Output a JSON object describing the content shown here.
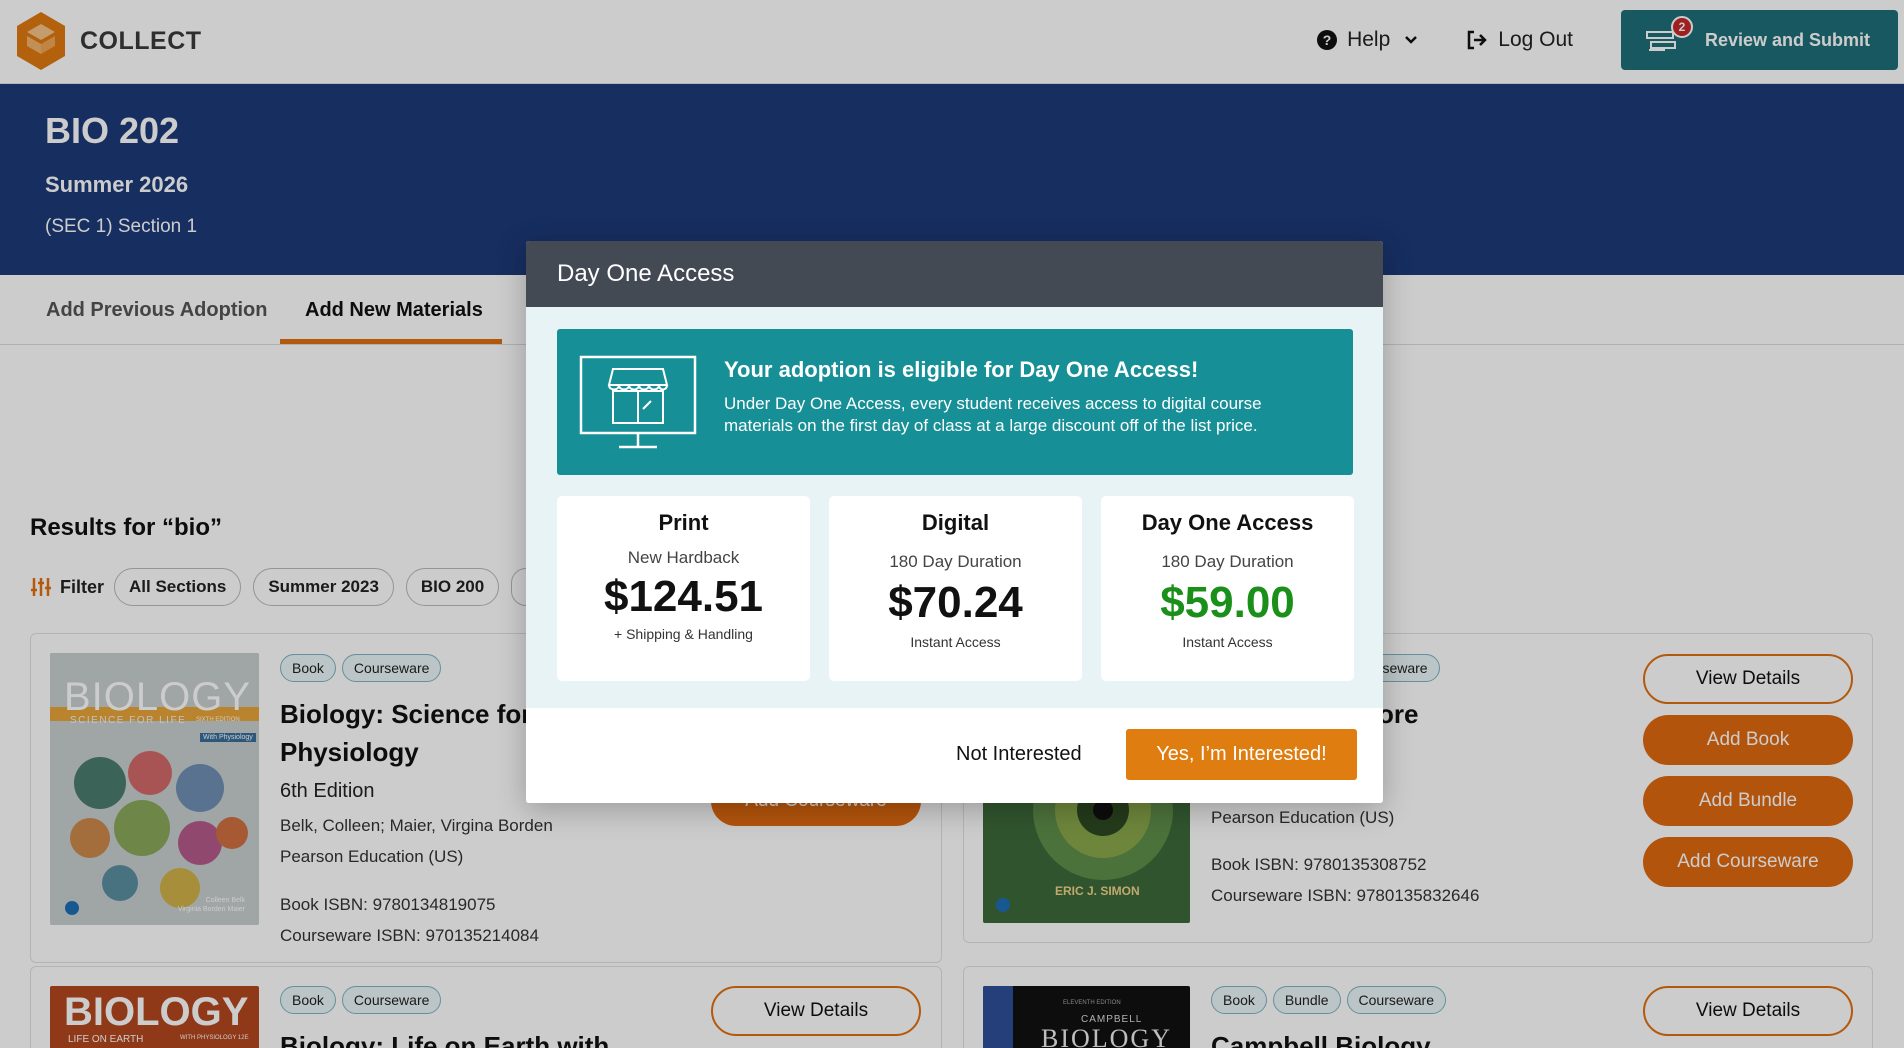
{
  "app": {
    "name": "COLLECT"
  },
  "header": {
    "help_label": "Help",
    "logout_label": "Log Out",
    "review_label": "Review and Submit",
    "review_badge": "2"
  },
  "course": {
    "code": "BIO 202",
    "term": "Summer 2026",
    "section": "(SEC 1) Section 1"
  },
  "tabs": [
    {
      "label": "Add Previous Adoption"
    },
    {
      "label": "Add New Materials"
    }
  ],
  "results": {
    "title": "Results for “bio”",
    "filter_label": "Filter",
    "chips": [
      "All Sections",
      "Summer 2023",
      "BIO 200"
    ]
  },
  "cards": [
    {
      "tags": [
        "Book",
        "Courseware"
      ],
      "title_line1": "Biology: Science for L",
      "title_line2": "Physiology",
      "edition": "6th Edition",
      "authors": "Belk, Colleen; Maier, Virgina Borden",
      "publisher": "Pearson Education (US)",
      "book_isbn": "Book ISBN: 9780134819075",
      "courseware_isbn": "Courseware ISBN: 970135214084",
      "buttons": [
        "Add Courseware"
      ]
    },
    {
      "tags": [
        "urseware"
      ],
      "title": "ore",
      "publisher": "Pearson Education (US)",
      "book_isbn": "Book ISBN: 9780135308752",
      "courseware_isbn": "Courseware ISBN: 9780135832646",
      "buttons": [
        "View Details",
        "Add Book",
        "Add Bundle",
        "Add Courseware"
      ],
      "cover_author": "ERIC J. SIMON"
    },
    {
      "tags": [
        "Book",
        "Courseware"
      ],
      "title": "Biology: Life on Earth with",
      "buttons": [
        "View Details"
      ]
    },
    {
      "tags": [
        "Book",
        "Bundle",
        "Courseware"
      ],
      "title": "Campbell Biology",
      "buttons": [
        "View Details"
      ]
    }
  ],
  "covers": {
    "c1_title": "BIOLOGY",
    "c1_sub": "SCIENCE FOR LIFE",
    "c1_ed": "SIXTH EDITION",
    "c1_phys": "With Physiology",
    "c1_auth1": "Colleen Belk",
    "c1_auth2": "Virginia Borden Maier",
    "c3_title": "BIOLOGY",
    "c3_sub": "LIFE ON EARTH",
    "c3_sub2": "WITH PHYSIOLOGY 12E",
    "c4_small": "ELEVENTH EDITION",
    "c4_campbell": "CAMPBELL",
    "c4_title": "BIOLOGY"
  },
  "modal": {
    "title": "Day One Access",
    "promo_title": "Your adoption is eligible for Day One Access!",
    "promo_text": "Under Day One Access, every student receives access to digital course materials on the first day of class at a large discount off of the list price.",
    "options": [
      {
        "title": "Print",
        "sub": "New Hardback",
        "price": "$124.51",
        "foot": "+ Shipping & Handling"
      },
      {
        "title": "Digital",
        "sub": "180 Day Duration",
        "price": "$70.24",
        "foot": "Instant Access"
      },
      {
        "title": "Day One Access",
        "sub": "180 Day Duration",
        "price": "$59.00",
        "foot": "Instant Access"
      }
    ],
    "not_interested": "Not Interested",
    "yes_label": "Yes, I’m Interested!"
  },
  "colors": {
    "brand_orange": "#e07010",
    "banner_navy": "#1c3a78",
    "teal": "#168f96",
    "modal_header": "#434a54",
    "price_green": "#1a8f1a"
  }
}
